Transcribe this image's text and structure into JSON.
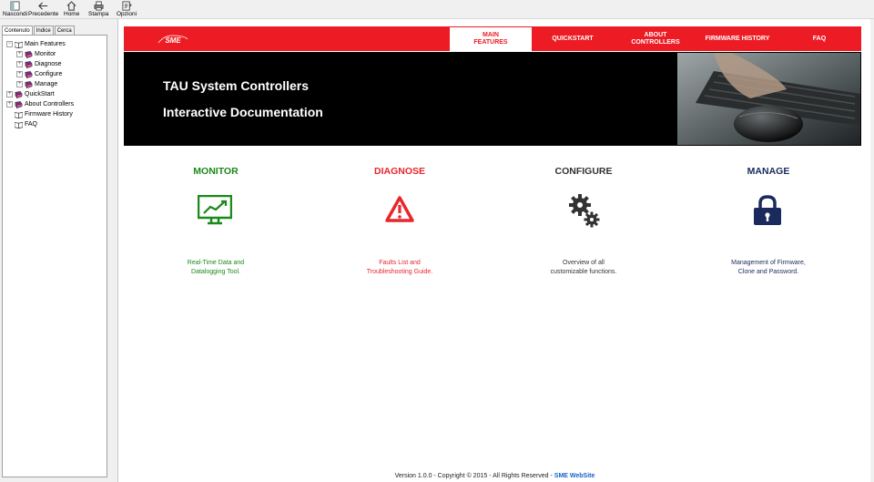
{
  "toolbar": {
    "buttons": [
      {
        "label": "Nascondi",
        "icon": "hide-pane-icon"
      },
      {
        "label": "Precedente",
        "icon": "back-arrow-icon"
      },
      {
        "label": "Home",
        "icon": "home-icon"
      },
      {
        "label": "Stampa",
        "icon": "print-icon"
      },
      {
        "label": "Opzioni",
        "icon": "options-icon"
      }
    ]
  },
  "sidebar": {
    "tabs": [
      "Contenuto",
      "Indice",
      "Cerca"
    ],
    "tree": [
      {
        "label": "Main Features",
        "expander": "−",
        "icon": "open-book-icon"
      },
      {
        "label": "Monitor",
        "expander": "+",
        "icon": "closed-book-icon"
      },
      {
        "label": "Diagnose",
        "expander": "+",
        "icon": "closed-book-icon"
      },
      {
        "label": "Configure",
        "expander": "+",
        "icon": "closed-book-icon"
      },
      {
        "label": "Manage",
        "expander": "+",
        "icon": "closed-book-icon"
      },
      {
        "label": "QuickStart",
        "expander": "+",
        "icon": "closed-book-icon"
      },
      {
        "label": "About Controllers",
        "expander": "+",
        "icon": "closed-book-icon"
      },
      {
        "label": "Firmware History",
        "expander": "",
        "icon": "page-icon"
      },
      {
        "label": "FAQ",
        "expander": "",
        "icon": "page-icon"
      }
    ]
  },
  "nav": {
    "logo": "SME",
    "items": [
      {
        "line1": "MAIN",
        "line2": "FEATURES",
        "active": true
      },
      {
        "line1": "QUICKSTART",
        "line2": "",
        "active": false
      },
      {
        "line1": "ABOUT",
        "line2": "CONTROLLERS",
        "active": false
      },
      {
        "line1": "FIRMWARE HISTORY",
        "line2": "",
        "active": false
      },
      {
        "line1": "FAQ",
        "line2": "",
        "active": false
      }
    ]
  },
  "banner": {
    "line1": "TAU System Controllers",
    "line2": "Interactive Documentation"
  },
  "features": [
    {
      "title": "MONITOR",
      "desc1": "Real-Time Data and",
      "desc2": "Datalogging Tool.",
      "color": "#1a8a1a",
      "icon": "monitor-chart-icon"
    },
    {
      "title": "DIAGNOSE",
      "desc1": "Faults List and",
      "desc2": "Troubleshooting Guide.",
      "color": "#e8262c",
      "icon": "warning-triangle-icon"
    },
    {
      "title": "CONFIGURE",
      "desc1": "Overview of all",
      "desc2": "customizable functions.",
      "color": "#333333",
      "icon": "gears-icon"
    },
    {
      "title": "MANAGE",
      "desc1": "Management of Firmware,",
      "desc2": "Clone and Password.",
      "color": "#1a2a5c",
      "icon": "padlock-icon"
    }
  ],
  "footer": {
    "text": "Version 1.0.0 - Copyright © 2015 - All Rights Reserved - ",
    "link": "SME WebSite"
  },
  "colors": {
    "brand_red": "#ed1c24",
    "monitor_green": "#1a8a1a",
    "diagnose_red": "#e8262c",
    "manage_navy": "#1a2a5c",
    "link_blue": "#1a5fd0"
  }
}
